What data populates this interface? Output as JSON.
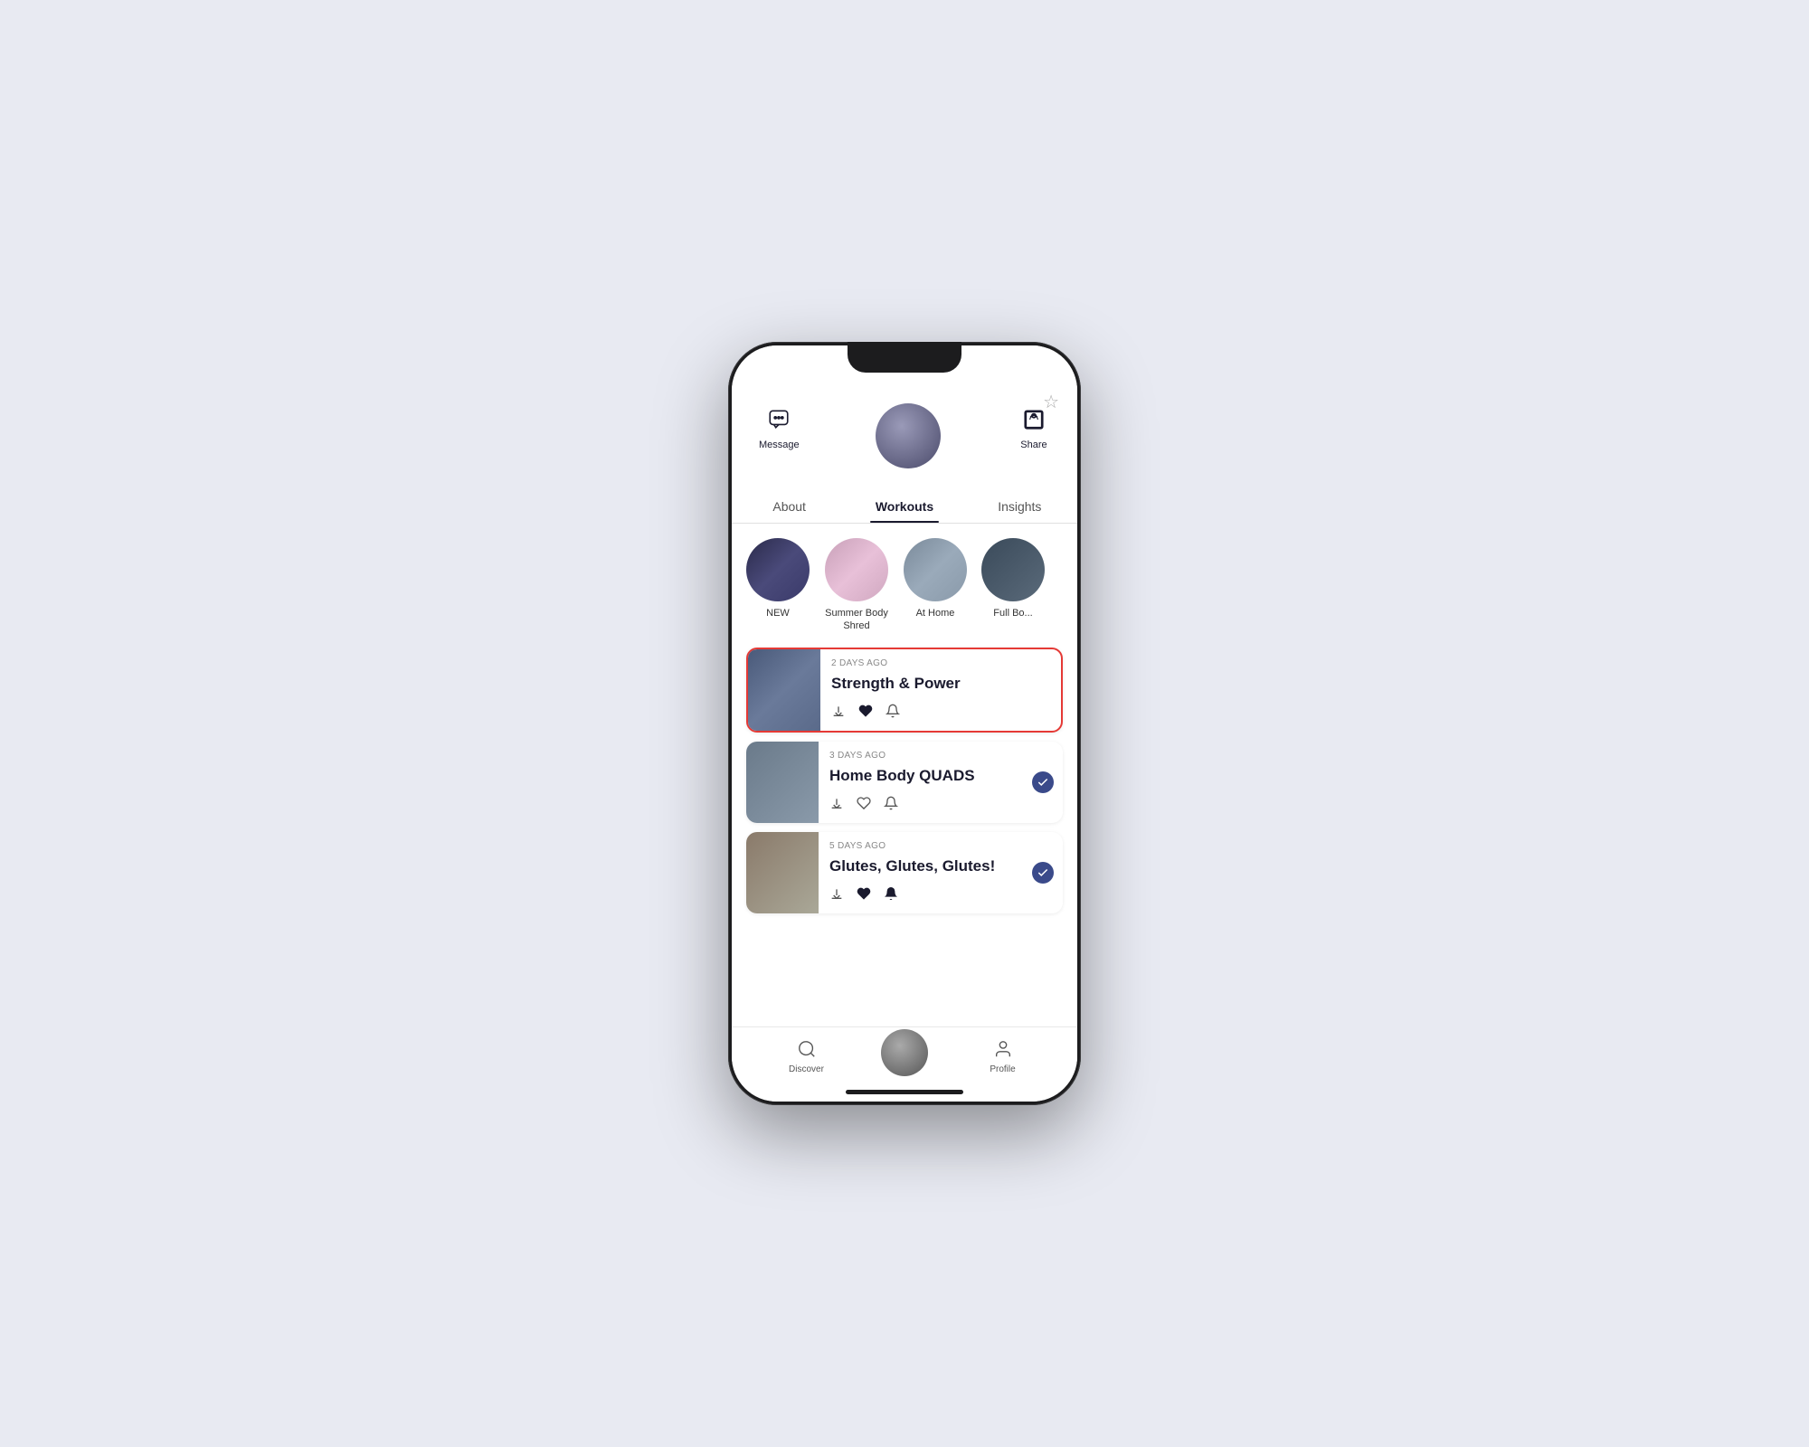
{
  "phone": {
    "star_icon": "☆"
  },
  "profile": {
    "message_label": "Message",
    "share_label": "Share"
  },
  "tabs": [
    {
      "id": "about",
      "label": "About",
      "active": false
    },
    {
      "id": "workouts",
      "label": "Workouts",
      "active": true
    },
    {
      "id": "insights",
      "label": "Insights",
      "active": false
    }
  ],
  "workout_circles": [
    {
      "id": "new",
      "label": "NEW",
      "img_class": "img-new"
    },
    {
      "id": "summer-body-shred",
      "label": "Summer Body Shred",
      "img_class": "img-summer"
    },
    {
      "id": "at-home",
      "label": "At Home",
      "img_class": "img-athome"
    },
    {
      "id": "full-body",
      "label": "Full Bo...",
      "img_class": "img-full"
    }
  ],
  "workout_cards": [
    {
      "id": "strength-power",
      "date": "2 DAYS AGO",
      "title": "Strength & Power",
      "img_class": "img-strength",
      "highlighted": true,
      "has_check": false,
      "icons": {
        "download": "↓",
        "heart": "♥",
        "bell": "🔔"
      },
      "heart_filled": true
    },
    {
      "id": "home-body-quads",
      "date": "3 DAYS AGO",
      "title": "Home Body QUADS",
      "img_class": "img-homebody",
      "highlighted": false,
      "has_check": true,
      "icons": {
        "download": "↓",
        "heart": "♡",
        "bell": "🔔"
      },
      "heart_filled": false
    },
    {
      "id": "glutes",
      "date": "5 DAYS AGO",
      "title": "Glutes, Glutes, Glutes!",
      "img_class": "img-glutes",
      "highlighted": false,
      "has_check": true,
      "icons": {
        "download": "↓",
        "heart": "♥",
        "bell": "🔔"
      },
      "heart_filled": true
    }
  ],
  "nav": {
    "discover_label": "Discover",
    "profile_label": "Profile"
  }
}
